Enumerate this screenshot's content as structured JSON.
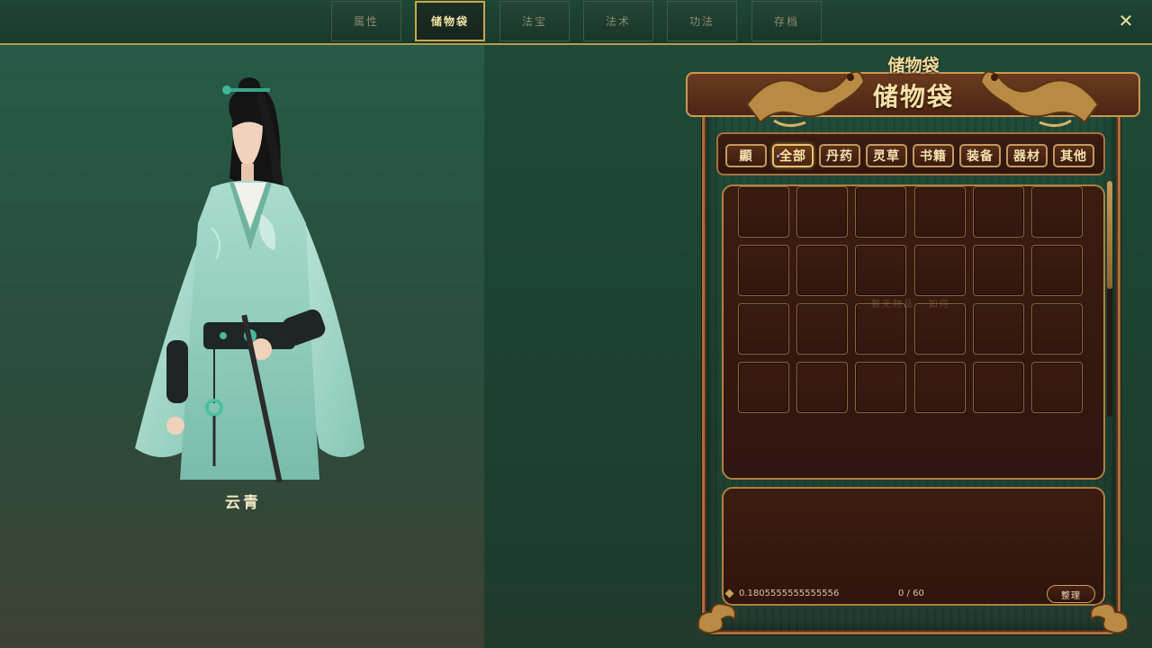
{
  "tabs": [
    {
      "label": "属性",
      "active": false
    },
    {
      "label": "储物袋",
      "active": true
    },
    {
      "label": "法宝",
      "active": false
    },
    {
      "label": "法术",
      "active": false
    },
    {
      "label": "功法",
      "active": false
    },
    {
      "label": "存档",
      "active": false
    }
  ],
  "close_label": "✕",
  "character": {
    "name": "云青"
  },
  "bag": {
    "title_top": "储物袋",
    "title": "储物袋",
    "filters": [
      {
        "label": "顯",
        "active": false
      },
      {
        "label": "全部",
        "active": true
      },
      {
        "label": "丹药",
        "active": false
      },
      {
        "label": "灵草",
        "active": false
      },
      {
        "label": "书籍",
        "active": false
      },
      {
        "label": "装备",
        "active": false
      },
      {
        "label": "器材",
        "active": false
      },
      {
        "label": "其他",
        "active": false
      }
    ],
    "hint": "暂无物品 · 如何",
    "stat_value": "0.1805555555555556",
    "capacity": "0 / 60",
    "sort_label": "整理"
  },
  "colors": {
    "accent_gold": "#c8a84a",
    "wood_dark": "#3c1d13",
    "bg_green": "#1f4a3a"
  }
}
